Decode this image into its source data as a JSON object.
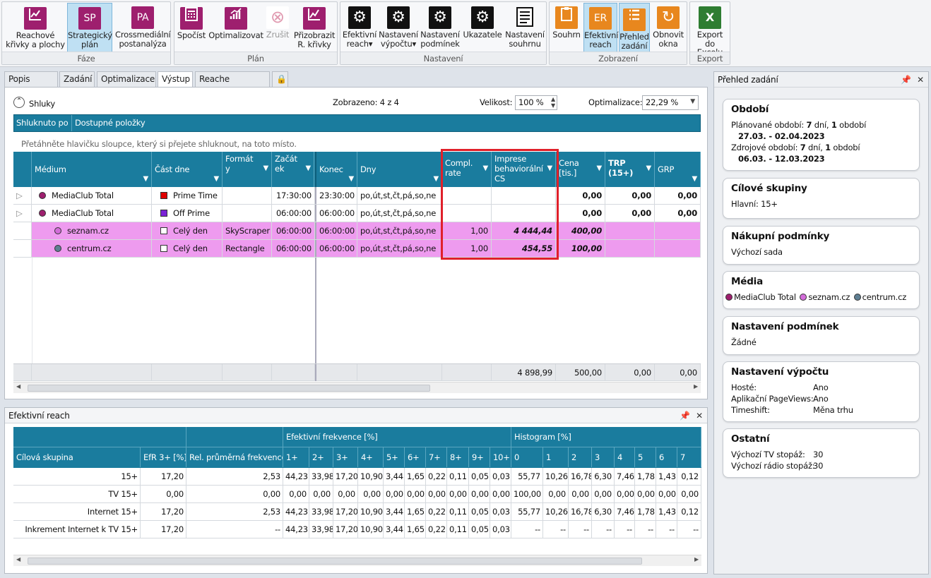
{
  "ribbon": {
    "groups": [
      {
        "label": "Fáze",
        "buttons": [
          {
            "label1": "Reachové",
            "label2": "křivky a plochy",
            "icon": "chart-icon"
          },
          {
            "label1": "Strategický",
            "label2": "plán",
            "icon_text": "SP",
            "active": true
          },
          {
            "label1": "Crossmediální",
            "label2": "postanalýza",
            "icon_text": "PA"
          }
        ]
      },
      {
        "label": "Plán",
        "buttons": [
          {
            "label1": "Spočíst",
            "label2": ""
          },
          {
            "label1": "Optimalizovat",
            "label2": ""
          },
          {
            "label1": "Zrušit",
            "label2": "",
            "disabled": true
          },
          {
            "label1": "Přizobrazit",
            "label2": "R. křivky"
          }
        ]
      },
      {
        "label": "Nastavení",
        "buttons": [
          {
            "label1": "Efektivní",
            "label2": "reach▾"
          },
          {
            "label1": "Nastavení",
            "label2": "výpočtu▾"
          },
          {
            "label1": "Nastavení",
            "label2": "podmínek"
          },
          {
            "label1": "Ukazatele",
            "label2": ""
          },
          {
            "label1": "Nastavení",
            "label2": "souhrnu"
          }
        ]
      },
      {
        "label": "Zobrazení",
        "buttons": [
          {
            "label1": "Souhrn",
            "label2": ""
          },
          {
            "label1": "Efektivní",
            "label2": "reach",
            "icon_text": "ER",
            "active": true
          },
          {
            "label1": "Přehled",
            "label2": "zadání",
            "active": true
          },
          {
            "label1": "Obnovit",
            "label2": "okna"
          }
        ]
      },
      {
        "label": "Export",
        "buttons": [
          {
            "label1": "Export",
            "label2": "do Excelu",
            "icon_text": "X"
          }
        ]
      }
    ]
  },
  "tabs": [
    "Popis plánu",
    "Zadání",
    "Optimalizace",
    "Výstup",
    "Reache frekvencí"
  ],
  "toolbar": {
    "shluky": "Shluky",
    "zobrazeno": "Zobrazeno: 4 z 4",
    "velikost_label": "Velikost:",
    "velikost_value": "100 %",
    "optimalizace_label": "Optimalizace:",
    "optimalizace_value": "22,29 %"
  },
  "grouping": {
    "col1": "Shluknuto po",
    "col2": "Dostupné položky",
    "hint": "Přetáhněte hlavičku sloupce, který si přejete shluknout, na toto místo."
  },
  "grid": {
    "columns": [
      "Médium",
      "Část dne",
      "Formát\ny",
      "Začát\nek",
      "Konec",
      "Dny",
      "Compl.\nrate",
      "Imprese\nbehaviorální\nCS",
      "Cena\n[tis.]",
      "TRP\n(15+)",
      "GRP"
    ],
    "rows": [
      {
        "medium": "MediaClub Total",
        "dot": "#9e1f6e",
        "cast": "Prime Time",
        "sq": "#e00000",
        "format": "",
        "start": "17:30:00",
        "end": "23:30:00",
        "dny": "po,út,st,čt,pá,so,ne",
        "compl": "",
        "imprese": "",
        "cena": "0,00",
        "trp": "0,00",
        "grp": "0,00",
        "pink": false
      },
      {
        "medium": "MediaClub Total",
        "dot": "#9e1f6e",
        "cast": "Off Prime",
        "sq": "#7a22d6",
        "format": "",
        "start": "06:00:00",
        "end": "06:00:00",
        "dny": "po,út,st,čt,pá,so,ne",
        "compl": "",
        "imprese": "",
        "cena": "0,00",
        "trp": "0,00",
        "grp": "0,00",
        "pink": false
      },
      {
        "medium": "seznam.cz",
        "dot": "#d36dd9",
        "cast": "Celý den",
        "sq": "#ffffff",
        "format": "SkyScraper",
        "start": "06:00:00",
        "end": "06:00:00",
        "dny": "po,út,st,čt,pá,so,ne",
        "compl": "1,00",
        "imprese": "4 444,44",
        "cena": "400,00",
        "trp": "",
        "grp": "",
        "pink": true
      },
      {
        "medium": "centrum.cz",
        "dot": "#5f7f93",
        "cast": "Celý den",
        "sq": "#ffffff",
        "format": "Rectangle",
        "start": "06:00:00",
        "end": "06:00:00",
        "dny": "po,út,st,čt,pá,so,ne",
        "compl": "1,00",
        "imprese": "454,55",
        "cena": "100,00",
        "trp": "",
        "grp": "",
        "pink": true
      }
    ],
    "totals": {
      "imprese": "4 898,99",
      "cena": "500,00",
      "trp": "0,00",
      "grp": "0,00"
    }
  },
  "reach": {
    "title": "Efektivní reach",
    "group_headers": {
      "freq": "Efektivní frekvence [%]",
      "hist": "Histogram [%]"
    },
    "columns": [
      "Cílová skupina",
      "EfR 3+ [%]",
      "Rel. průměrná frekvence",
      "1+",
      "2+",
      "3+",
      "4+",
      "5+",
      "6+",
      "7+",
      "8+",
      "9+",
      "10+",
      "0",
      "1",
      "2",
      "3",
      "4",
      "5",
      "6",
      "7"
    ],
    "rows": [
      [
        "15+",
        "17,20",
        "2,53",
        "44,23",
        "33,98",
        "17,20",
        "10,90",
        "3,44",
        "1,65",
        "0,22",
        "0,11",
        "0,05",
        "0,03",
        "55,77",
        "10,26",
        "16,78",
        "6,30",
        "7,46",
        "1,78",
        "1,43",
        "0,12"
      ],
      [
        "TV 15+",
        "0,00",
        "0,00",
        "0,00",
        "0,00",
        "0,00",
        "0,00",
        "0,00",
        "0,00",
        "0,00",
        "0,00",
        "0,00",
        "0,00",
        "100,00",
        "0,00",
        "0,00",
        "0,00",
        "0,00",
        "0,00",
        "0,00",
        "0,00"
      ],
      [
        "Internet 15+",
        "17,20",
        "2,53",
        "44,23",
        "33,98",
        "17,20",
        "10,90",
        "3,44",
        "1,65",
        "0,22",
        "0,11",
        "0,05",
        "0,03",
        "55,77",
        "10,26",
        "16,78",
        "6,30",
        "7,46",
        "1,78",
        "1,43",
        "0,12"
      ],
      [
        "Inkrement Internet k TV 15+",
        "17,20",
        "--",
        "44,23",
        "33,98",
        "17,20",
        "10,90",
        "3,44",
        "1,65",
        "0,22",
        "0,11",
        "0,05",
        "0,03",
        "--",
        "--",
        "--",
        "--",
        "--",
        "--",
        "--",
        "--"
      ]
    ]
  },
  "overview": {
    "title": "Přehled zadání",
    "obdobi": {
      "title": "Období",
      "planned_prefix": "Plánované období: ",
      "planned_days": "7",
      "planned_mid": " dní, ",
      "planned_count": "1",
      "planned_suffix": " období",
      "planned_range": "27.03. - 02.04.2023",
      "source_prefix": "Zdrojové období: ",
      "source_days": "7",
      "source_mid": " dní, ",
      "source_count": "1",
      "source_suffix": " období",
      "source_range": "06.03. - 12.03.2023"
    },
    "cilove": {
      "title": "Cílové skupiny",
      "line": "Hlavní:  15+"
    },
    "nakupni": {
      "title": "Nákupní podmínky",
      "line": "Výchozí sada"
    },
    "media": {
      "title": "Média",
      "items": [
        {
          "name": "MediaClub Total",
          "color": "#9e1f6e"
        },
        {
          "name": "seznam.cz",
          "color": "#d36dd9"
        },
        {
          "name": "centrum.cz",
          "color": "#5f7f93"
        }
      ]
    },
    "podminky": {
      "title": "Nastavení podmínek",
      "line": "Žádné"
    },
    "vypocet": {
      "title": "Nastavení výpočtu",
      "items": [
        {
          "k": "Hosté:",
          "v": "Ano"
        },
        {
          "k": "Aplikační PageViews:",
          "v": "Ano"
        },
        {
          "k": "Timeshift:",
          "v": "Měna trhu"
        }
      ]
    },
    "ostatni": {
      "title": "Ostatní",
      "items": [
        {
          "k": "Výchozí TV stopáž:",
          "v": "30"
        },
        {
          "k": "Výchozí rádio stopáž:",
          "v": "30"
        }
      ]
    }
  },
  "colors": {
    "header": "#1a7c9e",
    "highlight": "#ee9bef",
    "callout": "#e0202a"
  }
}
